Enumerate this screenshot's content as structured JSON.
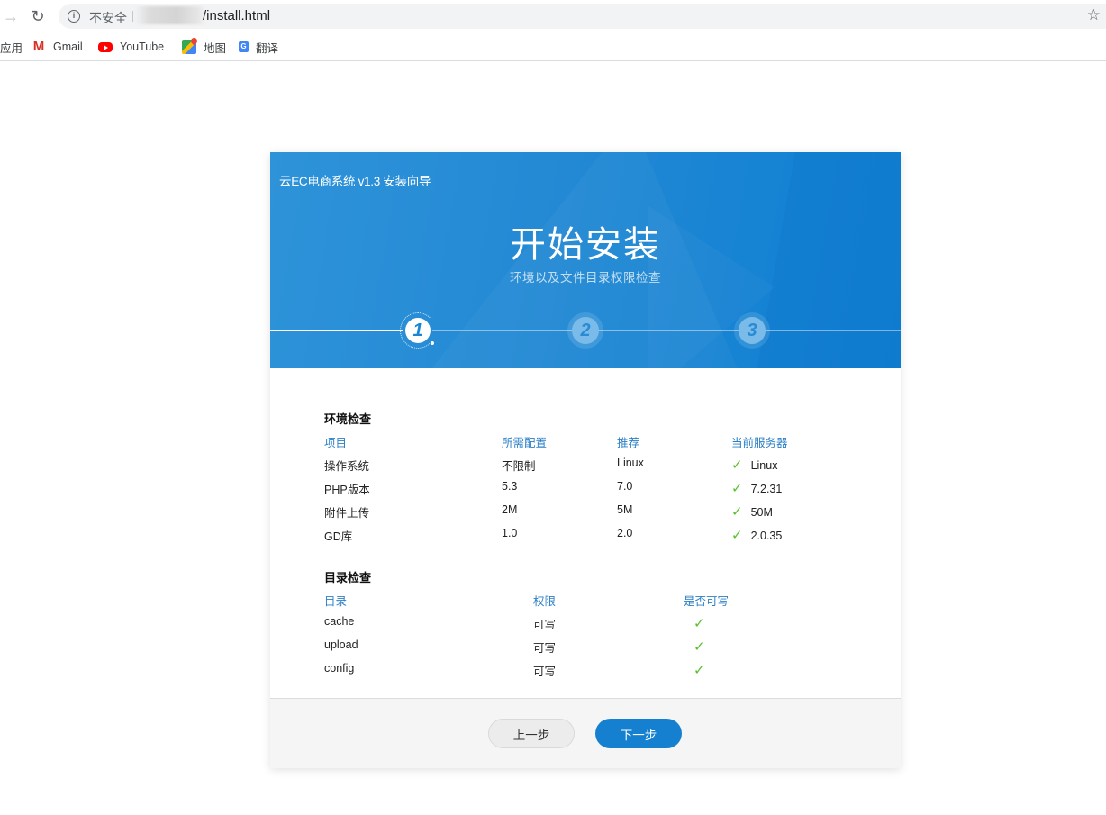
{
  "browser": {
    "security_label": "不安全",
    "url_visible": "/install.html",
    "bookmarks": [
      {
        "label": "应用",
        "icon": "apps-icon"
      },
      {
        "label": "Gmail",
        "icon": "gmail-icon"
      },
      {
        "label": "YouTube",
        "icon": "youtube-icon"
      },
      {
        "label": "地图",
        "icon": "maps-icon"
      },
      {
        "label": "翻译",
        "icon": "translate-icon"
      }
    ]
  },
  "header": {
    "app_title": "云EC电商系统 v1.3 安装向导",
    "heading": "开始安装",
    "subheading": "环境以及文件目录权限检查"
  },
  "steps": [
    {
      "number": "1",
      "state": "active"
    },
    {
      "number": "2",
      "state": "pending"
    },
    {
      "number": "3",
      "state": "pending"
    }
  ],
  "env_check": {
    "title": "环境检查",
    "columns": [
      "项目",
      "所需配置",
      "推荐",
      "当前服务器"
    ],
    "rows": [
      {
        "item": "操作系统",
        "required": "不限制",
        "recommended": "Linux",
        "current": "Linux",
        "ok": true
      },
      {
        "item": "PHP版本",
        "required": "5.3",
        "recommended": "7.0",
        "current": "7.2.31",
        "ok": true
      },
      {
        "item": "附件上传",
        "required": "2M",
        "recommended": "5M",
        "current": "50M",
        "ok": true
      },
      {
        "item": "GD库",
        "required": "1.0",
        "recommended": "2.0",
        "current": "2.0.35",
        "ok": true
      }
    ]
  },
  "dir_check": {
    "title": "目录检查",
    "columns": [
      "目录",
      "权限",
      "是否可写"
    ],
    "rows": [
      {
        "dir": "cache",
        "permission": "可写",
        "writable": true
      },
      {
        "dir": "upload",
        "permission": "可写",
        "writable": true
      },
      {
        "dir": "config",
        "permission": "可写",
        "writable": true
      }
    ]
  },
  "icons": {
    "check": "✓",
    "star": "☆",
    "reload": "↻",
    "forward": "→",
    "info": "i"
  },
  "footer": {
    "prev_label": "上一步",
    "next_label": "下一步"
  },
  "colors": {
    "accent": "#1480cf",
    "header_text": "#2b7fc6",
    "ok": "#5ac02c"
  }
}
